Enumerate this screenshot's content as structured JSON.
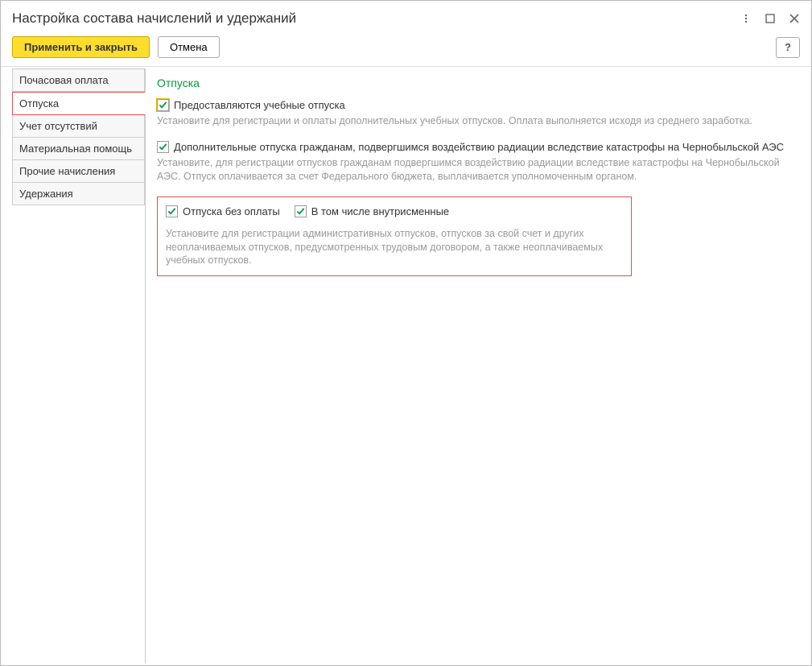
{
  "window": {
    "title": "Настройка состава начислений и удержаний"
  },
  "toolbar": {
    "apply_label": "Применить и закрыть",
    "cancel_label": "Отмена",
    "help_label": "?"
  },
  "sidebar": {
    "items": [
      {
        "label": "Почасовая оплата"
      },
      {
        "label": "Отпуска"
      },
      {
        "label": "Учет отсутствий"
      },
      {
        "label": "Материальная помощь"
      },
      {
        "label": "Прочие начисления"
      },
      {
        "label": "Удержания"
      }
    ],
    "selected_index": 1
  },
  "content": {
    "heading": "Отпуска",
    "opt_study": {
      "label": "Предоставляются учебные отпуска",
      "hint": "Установите для регистрации и оплаты дополнительных учебных отпусков. Оплата выполняется исходя из среднего заработка."
    },
    "opt_chernobyl": {
      "label": "Дополнительные отпуска гражданам, подвергшимся воздействию радиации вследствие катастрофы на Чернобыльской АЭС",
      "hint": "Установите, для регистрации отпусков гражданам подвергшимся воздействию радиации вследствие катастрофы на Чернобыльской АЭС. Отпуск оплачивается за счет Федерального бюджета, выплачивается уполномоченным органом."
    },
    "opt_unpaid": {
      "label": "Отпуска без оплаты",
      "sub_label": "В том числе внутрисменные",
      "hint": "Установите для регистрации административных отпусков, отпусков за свой счет и других неоплачиваемых отпусков, предусмотренных трудовым договором, а также неоплачиваемых учебных отпусков."
    }
  }
}
